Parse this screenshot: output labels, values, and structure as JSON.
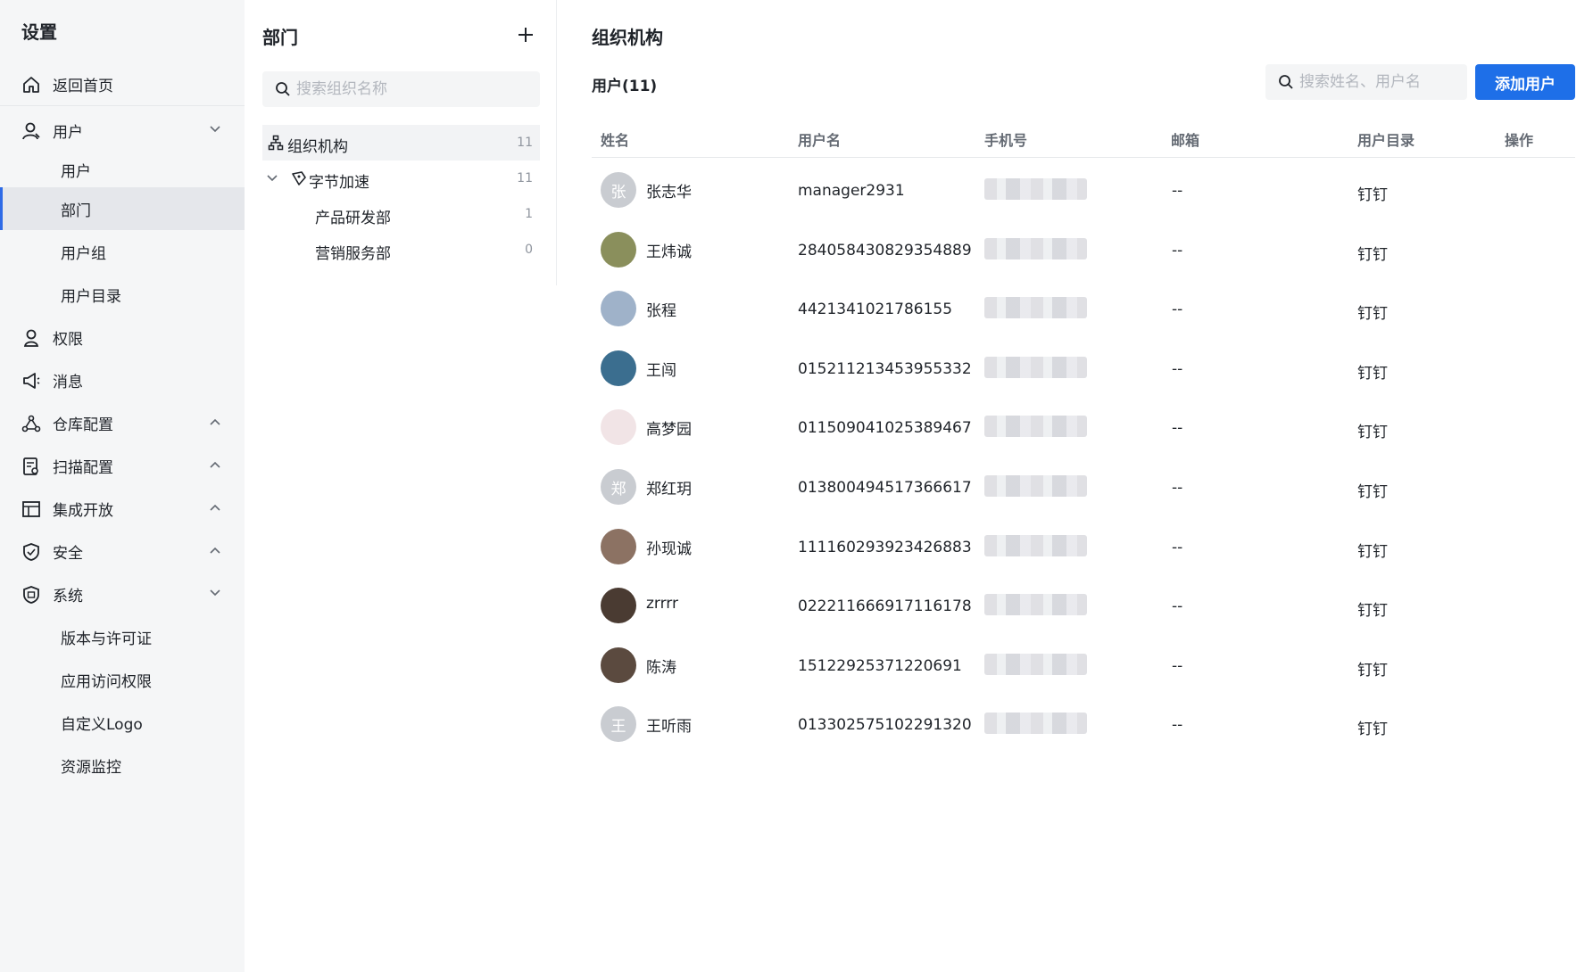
{
  "sidebar": {
    "title": "设置",
    "items": [
      {
        "label": "返回首页",
        "icon": "home-icon"
      },
      {
        "label": "用户",
        "icon": "user-icon",
        "chevron": "down"
      },
      {
        "label": "用户",
        "sub": true
      },
      {
        "label": "部门",
        "sub": true,
        "active": true
      },
      {
        "label": "用户组",
        "sub": true
      },
      {
        "label": "用户目录",
        "sub": true
      },
      {
        "label": "权限",
        "icon": "permission-icon"
      },
      {
        "label": "消息",
        "icon": "megaphone-icon"
      },
      {
        "label": "仓库配置",
        "icon": "repository-icon",
        "chevron": "up"
      },
      {
        "label": "扫描配置",
        "icon": "scan-config-icon",
        "chevron": "up"
      },
      {
        "label": "集成开放",
        "icon": "integration-icon",
        "chevron": "up"
      },
      {
        "label": "安全",
        "icon": "shield-icon",
        "chevron": "up"
      },
      {
        "label": "系统",
        "icon": "system-icon",
        "chevron": "down"
      },
      {
        "label": "版本与许可证",
        "sub": true
      },
      {
        "label": "应用访问权限",
        "sub": true
      },
      {
        "label": "自定义Logo",
        "sub": true
      },
      {
        "label": "资源监控",
        "sub": true
      }
    ]
  },
  "dept": {
    "title": "部门",
    "search_placeholder": "搜索组织名称",
    "tree": [
      {
        "label": "组织机构",
        "count": "11"
      },
      {
        "label": "字节加速",
        "count": "11"
      },
      {
        "label": "产品研发部",
        "count": "1"
      },
      {
        "label": "营销服务部",
        "count": "0"
      }
    ]
  },
  "main": {
    "title": "组织机构",
    "users_count": "用户(11)",
    "search_placeholder": "搜索姓名、用户名",
    "add_button": "添加用户",
    "columns": [
      "姓名",
      "用户名",
      "手机号",
      "邮箱",
      "用户目录",
      "操作"
    ],
    "rows": [
      {
        "name": "张志华",
        "avatar_text": "张",
        "avatar_color": "#c9ccd1",
        "username": "manager2931",
        "email": "--",
        "directory": "钉钉"
      },
      {
        "name": "王炜诚",
        "avatar_text": "",
        "avatar_color": "#8a8f5c",
        "username": "284058430829354889",
        "email": "--",
        "directory": "钉钉"
      },
      {
        "name": "张程",
        "avatar_text": "",
        "avatar_color": "#9fb2c9",
        "username": "4421341021786155",
        "email": "--",
        "directory": "钉钉"
      },
      {
        "name": "王闯",
        "avatar_text": "",
        "avatar_color": "#3b6e8f",
        "username": "015211213453955332",
        "email": "--",
        "directory": "钉钉"
      },
      {
        "name": "高梦园",
        "avatar_text": "",
        "avatar_color": "#f1e4e6",
        "username": "011509041025389467...",
        "email": "--",
        "directory": "钉钉"
      },
      {
        "name": "郑红玥",
        "avatar_text": "郑",
        "avatar_color": "#c9ccd1",
        "username": "013800494517366617...",
        "email": "--",
        "directory": "钉钉"
      },
      {
        "name": "孙现诚",
        "avatar_text": "",
        "avatar_color": "#8c7263",
        "username": "111160293923426883",
        "email": "--",
        "directory": "钉钉"
      },
      {
        "name": "zrrrr",
        "avatar_text": "",
        "avatar_color": "#4a3b32",
        "username": "022211666917116178...",
        "email": "--",
        "directory": "钉钉"
      },
      {
        "name": "陈涛",
        "avatar_text": "",
        "avatar_color": "#5b4a3f",
        "username": "15122925371220691",
        "email": "--",
        "directory": "钉钉"
      },
      {
        "name": "王听雨",
        "avatar_text": "王",
        "avatar_color": "#c9ccd1",
        "username": "013302575102291320...",
        "email": "--",
        "directory": "钉钉"
      }
    ]
  },
  "colors": {
    "accent": "#1e6fe8",
    "sidebar_bg": "#f5f6f7",
    "active_bar": "#2e6be6"
  }
}
